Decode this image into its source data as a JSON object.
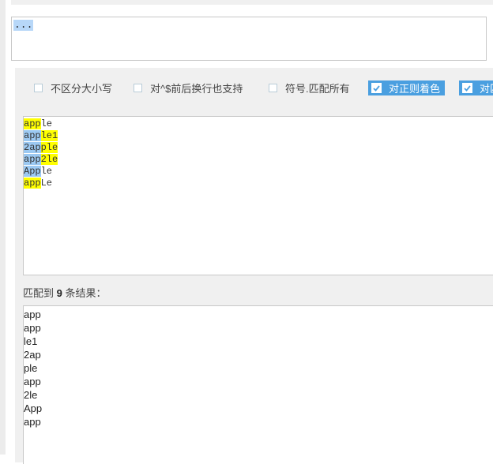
{
  "regex": {
    "value": "..."
  },
  "options": [
    {
      "label": "不区分大小写",
      "checked": false,
      "name": "option-ignore-case"
    },
    {
      "label": "对^$前后换行也支持",
      "checked": false,
      "name": "option-multiline"
    },
    {
      "label": "符号.匹配所有",
      "checked": false,
      "name": "option-dotall"
    },
    {
      "label": "对正则着色",
      "checked": true,
      "name": "option-color-regex"
    },
    {
      "label": "对匹",
      "checked": true,
      "name": "option-color-matches"
    }
  ],
  "source_lines": [
    [
      {
        "t": "app",
        "bg": "#ffff00"
      },
      {
        "t": "le",
        "bg": ""
      }
    ],
    [
      {
        "t": "app",
        "bg": "#9cc9f2"
      },
      {
        "t": "le1",
        "bg": "#ffff00"
      }
    ],
    [
      {
        "t": "2ap",
        "bg": "#9cc9f2"
      },
      {
        "t": "ple",
        "bg": "#ffff00"
      }
    ],
    [
      {
        "t": "app",
        "bg": "#9cc9f2"
      },
      {
        "t": "2le",
        "bg": "#ffff00"
      }
    ],
    [
      {
        "t": "App",
        "bg": "#9cc9f2"
      },
      {
        "t": "le",
        "bg": ""
      }
    ],
    [
      {
        "t": "app",
        "bg": "#ffff00"
      },
      {
        "t": "Le",
        "bg": ""
      }
    ]
  ],
  "result": {
    "label_prefix": "匹配到 ",
    "count": "9",
    "label_suffix": " 条结果：",
    "items": [
      "app",
      "app",
      "le1",
      "2ap",
      "ple",
      "app",
      "2le",
      "App",
      "app"
    ]
  },
  "colors": {
    "checked_bg": "#4a9fe0",
    "match_a": "#ffff00",
    "match_b": "#9cc9f2"
  }
}
